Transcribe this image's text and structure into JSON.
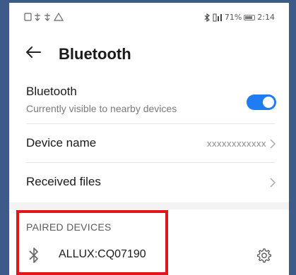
{
  "status_bar": {
    "left_icons": "ⓑ ⚡ ⚡ ⚠",
    "bluetooth_symbol": "✱",
    "signal_battery": "Ⅱş‡ ",
    "battery_percent": "71%",
    "time": "2:14"
  },
  "header": {
    "title": "Bluetooth",
    "back_icon": "arrow-left-icon"
  },
  "bluetooth_row": {
    "title": "Bluetooth",
    "subtitle": "Currently visible to nearby devices",
    "toggle_on": true
  },
  "device_name_row": {
    "title": "Device name",
    "value": "xxxxxxxxxxxx"
  },
  "received_files_row": {
    "title": "Received files"
  },
  "paired_section": {
    "header": "PAIRED DEVICES",
    "devices": [
      {
        "name": "ALLUX:CQ07190",
        "icon": "bluetooth-icon",
        "settings_icon": "gear-icon"
      }
    ]
  },
  "colors": {
    "accent": "#1f7cf2",
    "highlight_border": "#e2151b",
    "frame": "#3d5a89"
  }
}
